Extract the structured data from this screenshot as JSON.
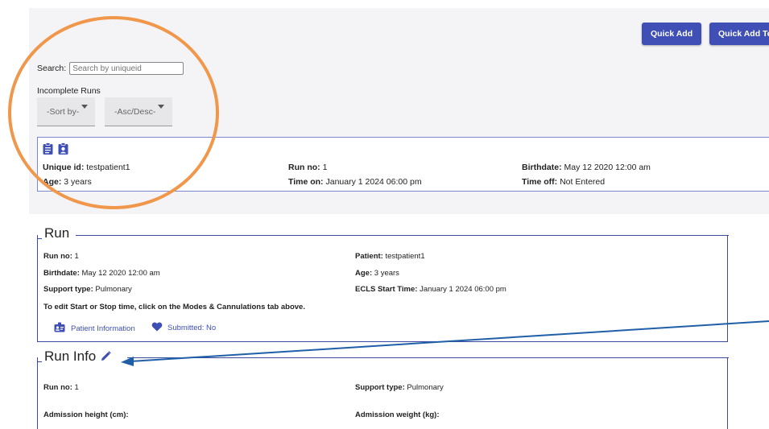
{
  "toolbar": {
    "quick_add": "Quick Add",
    "quick_add_test": "Quick Add Tes"
  },
  "search": {
    "label": "Search:",
    "placeholder": "Search by uniqueid"
  },
  "incomplete_runs": {
    "title": "Incomplete Runs",
    "sort_by": "-Sort by-",
    "order": "-Asc/Desc-"
  },
  "patient_card": {
    "unique_id_label": "Unique id:",
    "unique_id": "testpatient1",
    "age_label": "Age:",
    "age": "3 years",
    "run_no_label": "Run no:",
    "run_no": "1",
    "time_on_label": "Time on:",
    "time_on": "January 1 2024 06:00 pm",
    "birthdate_label": "Birthdate:",
    "birthdate": "May 12 2020 12:00 am",
    "time_off_label": "Time off:",
    "time_off": "Not Entered"
  },
  "run_section": {
    "title": "Run",
    "run_no_label": "Run no:",
    "run_no": "1",
    "patient_label": "Patient:",
    "patient": "testpatient1",
    "birthdate_label": "Birthdate:",
    "birthdate": "May 12 2020 12:00 am",
    "age_label": "Age:",
    "age": "3 years",
    "support_type_label": "Support type:",
    "support_type": "Pulmonary",
    "ecls_label": "ECLS Start Time:",
    "ecls_start": "January 1 2024 06:00 pm",
    "edit_note": "To edit Start or Stop time, click on the Modes & Cannulations tab above.",
    "patient_info_link": "Patient Information",
    "submitted_link": "Submitted: No"
  },
  "run_info_section": {
    "title": "Run Info",
    "run_no_label": "Run no:",
    "run_no": "1",
    "support_type_label": "Support type:",
    "support_type": "Pulmonary",
    "admission_height_label": "Admission height (cm):",
    "admission_weight_label": "Admission weight (kg):"
  },
  "colors": {
    "primary": "#3f4fb5",
    "annotation_circle": "#f1974c",
    "annotation_arrow": "#1f5fa8"
  }
}
